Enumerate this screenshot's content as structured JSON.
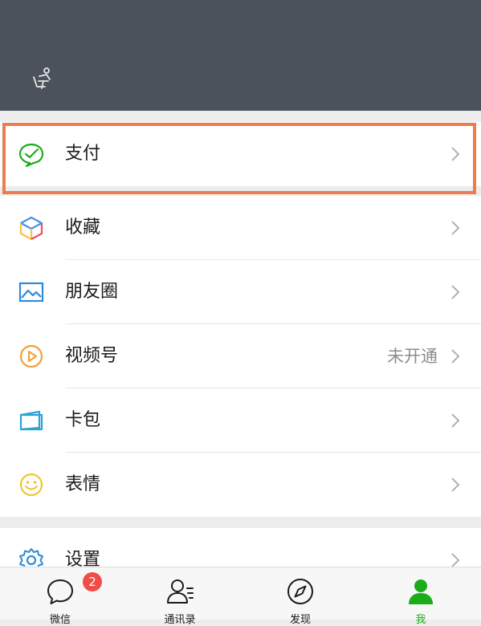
{
  "menu": {
    "pay": "支付",
    "favorites": "收藏",
    "moments": "朋友圈",
    "channels": "视频号",
    "channels_status": "未开通",
    "cards": "卡包",
    "stickers": "表情",
    "settings": "设置"
  },
  "tabbar": {
    "chats": "微信",
    "chats_badge": "2",
    "contacts": "通讯录",
    "discover": "发现",
    "me": "我"
  },
  "colors": {
    "header_bg": "#4b525c",
    "highlight": "#ee7b4f",
    "wechat_green": "#1aad19",
    "badge_red": "#f04d47"
  },
  "icons": {
    "pay": "wechat-pay-icon",
    "favorites": "cube-icon",
    "moments": "image-icon",
    "channels": "play-circle-icon",
    "cards": "card-wallet-icon",
    "stickers": "smile-icon",
    "settings": "gear-icon"
  }
}
